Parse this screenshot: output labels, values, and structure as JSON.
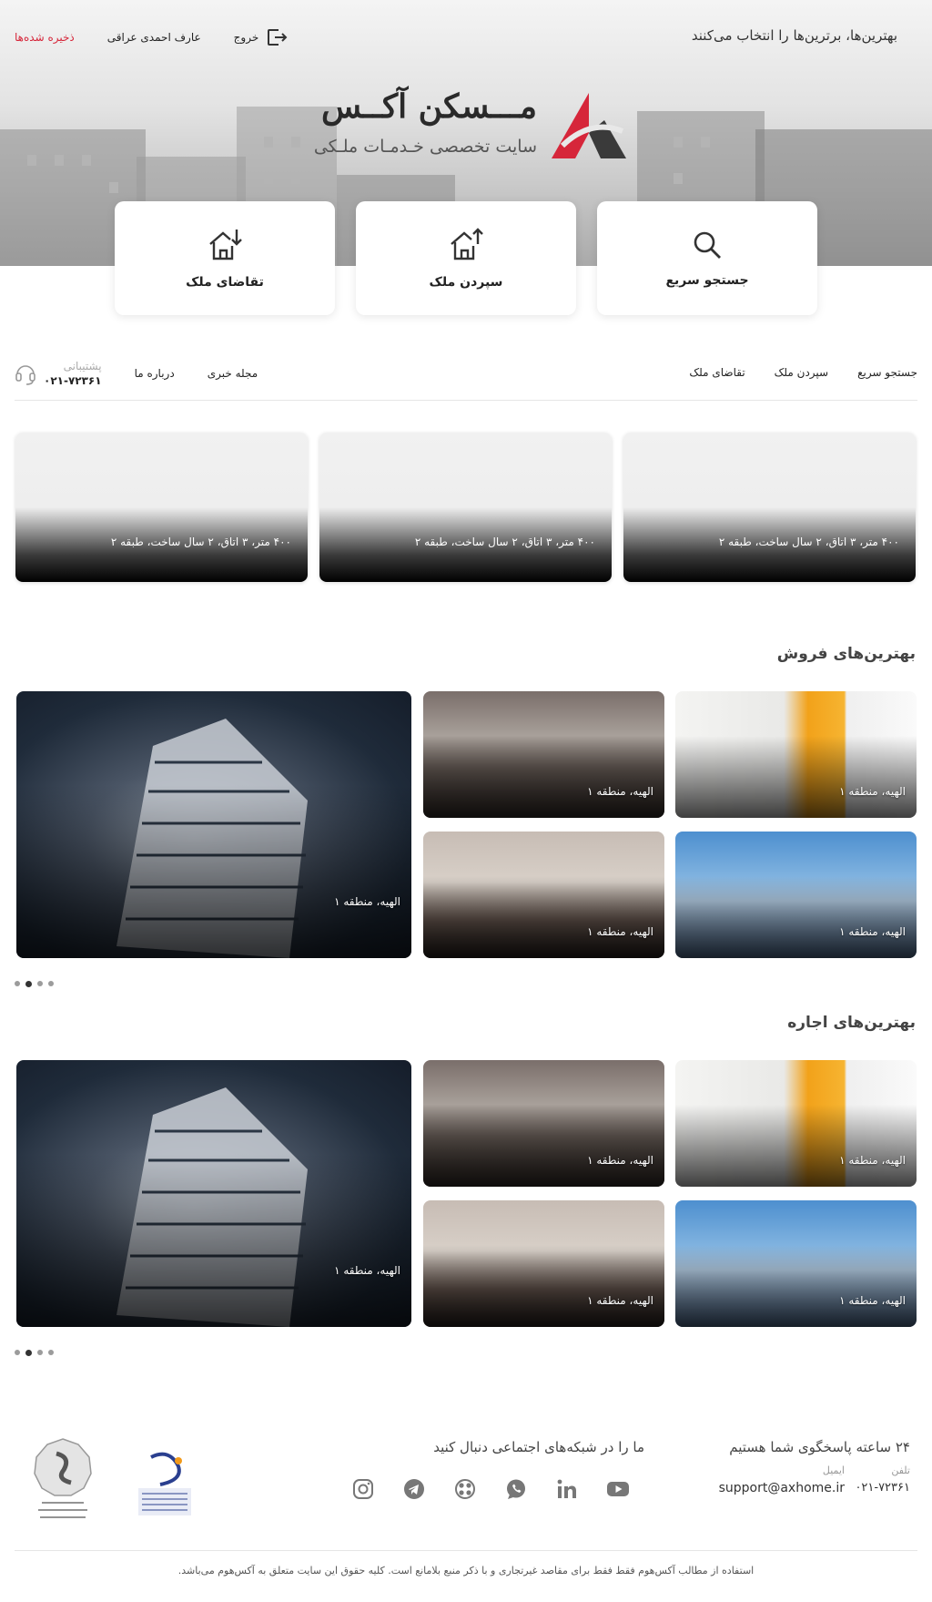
{
  "header": {
    "tagline": "بهترین‌ها، برترین‌ها را انتخاب می‌کنند",
    "saved_label": "ذخیره شده‌ها",
    "user_name": "عارف احمدی عراقی",
    "logout_label": "خروج",
    "brand_name": "مـــسکن آکــس",
    "brand_subtitle": "سایت تخصصی خـدمـات ملـکی"
  },
  "quick_actions": [
    {
      "label": "جستجو سریع",
      "icon": "search-icon"
    },
    {
      "label": "سپردن ملک",
      "icon": "house-upload-icon"
    },
    {
      "label": "تقاضای ملک",
      "icon": "house-download-icon"
    }
  ],
  "nav": {
    "items": [
      "جستجو سریع",
      "سپردن ملک",
      "تقاضای ملک"
    ],
    "secondary": [
      "مجله خبری",
      "درباره ما"
    ],
    "support_label": "پشتیبانی",
    "support_phone": "۰۲۱-۷۲۳۶۱"
  },
  "featured": [
    {
      "caption": "۴۰۰ متر، ۳ اتاق، ۲ سال ساخت، طبقه ۲"
    },
    {
      "caption": "۴۰۰ متر، ۳ اتاق، ۲ سال ساخت، طبقه ۲"
    },
    {
      "caption": "۴۰۰ متر، ۳ اتاق، ۲ سال ساخت، طبقه ۲"
    }
  ],
  "sections": [
    {
      "title": "بهترین‌های فروش",
      "cards": [
        "الهیه، منطقه ۱",
        "الهیه، منطقه ۱",
        "الهیه، منطقه ۱",
        "الهیه، منطقه ۱",
        "الهیه، منطقه ۱"
      ]
    },
    {
      "title": "بهترین‌های اجاره",
      "cards": [
        "الهیه، منطقه ۱",
        "الهیه، منطقه ۱",
        "الهیه، منطقه ۱",
        "الهیه، منطقه ۱",
        "الهیه، منطقه ۱"
      ]
    }
  ],
  "footer": {
    "support_title": "۲۴ ساعته پاسخگوی شما هستیم",
    "phone_label": "تلفن",
    "phone": "۰۲۱-۷۲۳۶۱",
    "email_label": "ایمیل",
    "email": "support@axhome.ir",
    "social_title": "ما را در شبکه‌های اجتماعی دنبال کنید",
    "social_icons": [
      "youtube-icon",
      "linkedin-icon",
      "whatsapp-icon",
      "aparat-icon",
      "telegram-icon",
      "instagram-icon"
    ],
    "copyright": "استفاده از مطالب آکس‌هوم فقط فقط برای مقاصد غیرتجاری و با ذکر منبع بلامانع است. کلیه حقوق این سایت متعلق  به آکس‌هوم می‌باشد."
  },
  "colors": {
    "accent": "#d6263a",
    "dark": "#222222"
  }
}
